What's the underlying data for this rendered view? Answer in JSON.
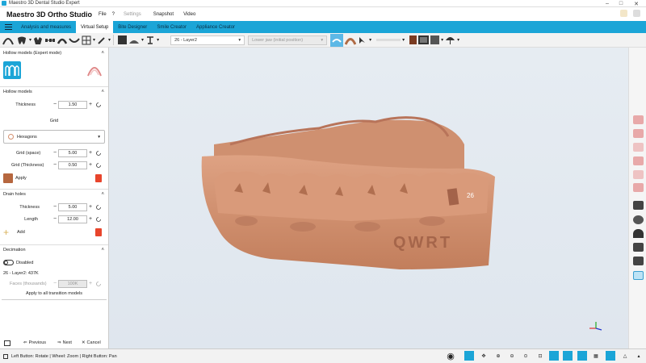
{
  "window": {
    "title": "Maestro 3D Dental Studio Expert"
  },
  "menu": {
    "app_name": "Maestro 3D Ortho Studio",
    "items": [
      "File",
      "?",
      "Settings",
      "Snapshot",
      "Video"
    ]
  },
  "tabs": [
    "Analysis and measures",
    "Virtual Setup",
    "Bite Designer",
    "Smile Creator",
    "Appliance Creator"
  ],
  "active_tab": "Virtual Setup",
  "toolbar": {
    "layer_select": "26 - Layer2",
    "position_select": "Lower jaw (initial position)"
  },
  "panel": {
    "hollow_expert": {
      "title": "Hollow models (Expert mode)"
    },
    "hollow": {
      "title": "Hollow models",
      "thickness_label": "Thickness",
      "thickness_value": "1.50",
      "grid_label": "Grid",
      "grid_type": "Hexagons",
      "grid_space_label": "Grid (space)",
      "grid_space_value": "5.00",
      "grid_thickness_label": "Grid (Thickness)",
      "grid_thickness_value": "0.50",
      "apply_label": "Apply"
    },
    "drain": {
      "title": "Drain holes",
      "thickness_label": "Thickness",
      "thickness_value": "5.00",
      "length_label": "Length",
      "length_value": "12.00",
      "add_label": "Add"
    },
    "decimation": {
      "title": "Decimation",
      "toggle_label": "Disabled",
      "model_info": "26 - Layer2: 437K",
      "faces_label": "Faces (thousands)",
      "faces_value": "100K",
      "apply_all_label": "Apply to all transition models"
    },
    "nav": {
      "previous": "Previous",
      "next": "Next",
      "cancel": "Cancel"
    }
  },
  "model": {
    "engraving": "QWRT",
    "tooth_tag": "26"
  },
  "status": {
    "hint": "Left Button: Rotate | Wheel: Zoom | Right Button: Pan"
  },
  "colors": {
    "accent": "#1ba5d7",
    "model": "#d4906e",
    "viewport": "#e3e9f0"
  }
}
